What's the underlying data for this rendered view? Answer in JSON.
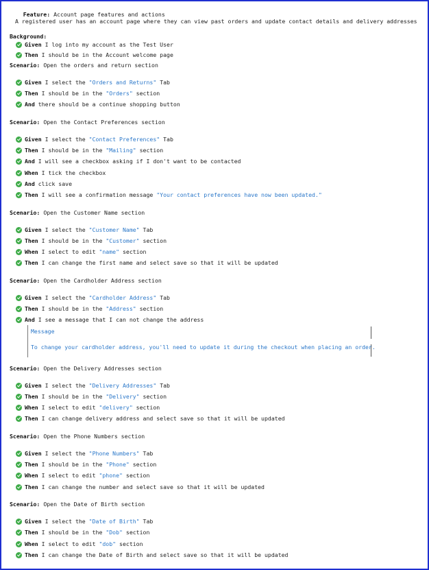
{
  "feature": {
    "keyword": "Feature:",
    "title": "Account page features and actions",
    "description": "A registered user has an account page where they can view past orders and update contact details and delivery addresses"
  },
  "background": {
    "keyword": "Background:",
    "steps": [
      {
        "keyword": "Given",
        "parts": [
          " I log into my account as the Test User"
        ]
      },
      {
        "keyword": "Then",
        "parts": [
          " I should be in the Account welcome page"
        ]
      }
    ]
  },
  "scenarios": [
    {
      "keyword": "Scenario:",
      "title": "Open the orders and return section",
      "steps": [
        {
          "keyword": "Given",
          "parts": [
            " I select the ",
            "\"Orders and Returns\"",
            " Tab"
          ]
        },
        {
          "keyword": "Then",
          "parts": [
            " I should be in the ",
            "\"Orders\"",
            " section"
          ]
        },
        {
          "keyword": "And",
          "parts": [
            " there should be a continue shopping button"
          ]
        }
      ]
    },
    {
      "keyword": "Scenario:",
      "title": "Open the Contact Preferences section",
      "steps": [
        {
          "keyword": "Given",
          "parts": [
            " I select the ",
            "\"Contact Preferences\"",
            " Tab"
          ]
        },
        {
          "keyword": "Then",
          "parts": [
            " I should be in the ",
            "\"Mailing\"",
            " section"
          ]
        },
        {
          "keyword": "And",
          "parts": [
            " I will see a checkbox asking if I don't want to be contacted"
          ]
        },
        {
          "keyword": "When",
          "parts": [
            " I tick the checkbox"
          ]
        },
        {
          "keyword": "And",
          "parts": [
            " click save"
          ]
        },
        {
          "keyword": "Then",
          "parts": [
            " I will see a confirmation message ",
            "\"Your contact preferences have now been updated.\""
          ]
        }
      ]
    },
    {
      "keyword": "Scenario:",
      "title": "Open the Customer Name section",
      "steps": [
        {
          "keyword": "Given",
          "parts": [
            " I select the ",
            "\"Customer Name\"",
            " Tab"
          ]
        },
        {
          "keyword": "Then",
          "parts": [
            " I should be in the ",
            "\"Customer\"",
            " section"
          ]
        },
        {
          "keyword": "When",
          "parts": [
            " I select to edit ",
            "\"name\"",
            " section"
          ]
        },
        {
          "keyword": "Then",
          "parts": [
            " I can change the first name and select save so that it will be updated"
          ]
        }
      ]
    },
    {
      "keyword": "Scenario:",
      "title": "Open the Cardholder Address section",
      "steps": [
        {
          "keyword": "Given",
          "parts": [
            " I select the ",
            "\"Cardholder Address\"",
            " Tab"
          ]
        },
        {
          "keyword": "Then",
          "parts": [
            " I should be in the ",
            "\"Address\"",
            " section"
          ]
        },
        {
          "keyword": "And",
          "parts": [
            " I see a message that I can not change the address"
          ]
        }
      ],
      "docstring": {
        "title": "Message",
        "text": "To change your cardholder address, you'll need to update it during the checkout when placing an order."
      }
    },
    {
      "keyword": "Scenario:",
      "title": "Open the Delivery Addresses section",
      "steps": [
        {
          "keyword": "Given",
          "parts": [
            " I select the ",
            "\"Delivery Addresses\"",
            " Tab"
          ]
        },
        {
          "keyword": "Then",
          "parts": [
            " I should be in the ",
            "\"Delivery\"",
            " section"
          ]
        },
        {
          "keyword": "When",
          "parts": [
            " I select to edit ",
            "\"delivery\"",
            " section"
          ]
        },
        {
          "keyword": "Then",
          "parts": [
            " I can change delivery address and select save so that it will be updated"
          ]
        }
      ]
    },
    {
      "keyword": "Scenario:",
      "title": "Open the Phone Numbers section",
      "steps": [
        {
          "keyword": "Given",
          "parts": [
            " I select the ",
            "\"Phone Numbers\"",
            " Tab"
          ]
        },
        {
          "keyword": "Then",
          "parts": [
            " I should be in the ",
            "\"Phone\"",
            " section"
          ]
        },
        {
          "keyword": "When",
          "parts": [
            " I select to edit ",
            "\"phone\"",
            " section"
          ]
        },
        {
          "keyword": "Then",
          "parts": [
            " I can change the number and select save so that it will be updated"
          ]
        }
      ]
    },
    {
      "keyword": "Scenario:",
      "title": "Open the Date of Birth section",
      "steps": [
        {
          "keyword": "Given",
          "parts": [
            " I select the ",
            "\"Date of Birth\"",
            " Tab"
          ]
        },
        {
          "keyword": "Then",
          "parts": [
            " I should be in the ",
            "\"Dob\"",
            " section"
          ]
        },
        {
          "keyword": "When",
          "parts": [
            " I select to edit ",
            "\"dob\"",
            " section"
          ]
        },
        {
          "keyword": "Then",
          "parts": [
            " I can change the Date of Birth and select save so that it will be updated"
          ]
        }
      ]
    }
  ],
  "icons": {
    "step_passed": "check-circle-icon"
  },
  "colors": {
    "border": "#1e2fd0",
    "passed": "#3eab48",
    "string": "#2a77c9"
  }
}
